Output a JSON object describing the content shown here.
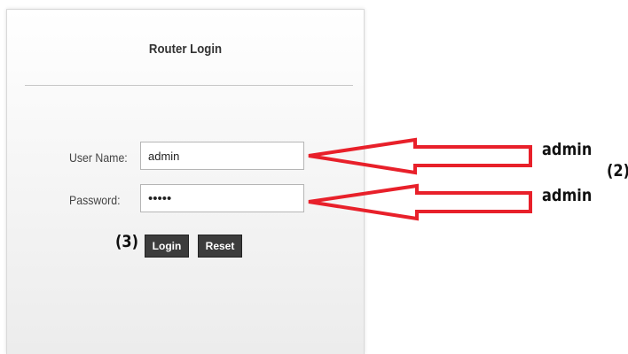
{
  "login": {
    "title": "Router Login",
    "username_label": "User Name:",
    "username_value": "admin",
    "password_label": "Password:",
    "password_value": "admin",
    "login_button": "Login",
    "reset_button": "Reset"
  },
  "annotations": {
    "username_hint": "admin",
    "password_hint": "admin",
    "step_credentials": "(2)",
    "step_login": "(3)",
    "arrow_color": "#e8202a"
  }
}
